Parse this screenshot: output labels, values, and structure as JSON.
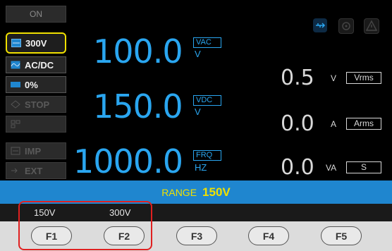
{
  "sidebar": {
    "on_label": "ON",
    "range_label": "300V",
    "mode_label": "AC/DC",
    "percent_label": "0%",
    "stop_label": "STOP",
    "imp_label": "IMP",
    "ext_label": "EXT"
  },
  "readings": {
    "vac": {
      "value": "100.0",
      "tag": "VAC",
      "unit": "V"
    },
    "vdc": {
      "value": "150.0",
      "tag": "VDC",
      "unit": "V"
    },
    "frq": {
      "value": "1000.0",
      "tag": "FRQ",
      "unit": "HZ"
    }
  },
  "measurements": {
    "voltage": {
      "value": "0.5",
      "unit": "V",
      "tag": "Vrms"
    },
    "current": {
      "value": "0.0",
      "unit": "A",
      "tag": "Arms"
    },
    "power": {
      "value": "0.0",
      "unit": "VA",
      "tag": "S"
    }
  },
  "range_bar": {
    "label": "RANGE",
    "value": "150V"
  },
  "softkeys": {
    "f1_option": "150V",
    "f2_option": "300V",
    "keys": [
      "F1",
      "F2",
      "F3",
      "F4",
      "F5"
    ]
  },
  "colors": {
    "accent": "#2aa6f0",
    "range_bar": "#1f86cf",
    "highlight": "#f0e000",
    "annotation": "#e02020"
  }
}
